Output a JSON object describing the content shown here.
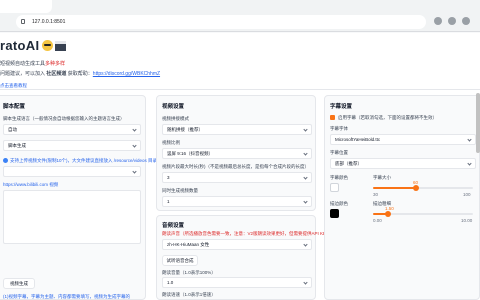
{
  "browser": {
    "url": "127.0.0.1:8501"
  },
  "header": {
    "title": "ratoAI",
    "subtitle_prefix": "短视频自动生成工具",
    "subtitle_highlight": "多种多样",
    "link_line_prefix": "问题建议，可以加入 ",
    "link_line_bold": "社区频道",
    "link_line_mid": " 获取帮助：",
    "link_text": "https://discord.gg/WBKChhmZ",
    "banner": "点击查看教程"
  },
  "left_panel": {
    "title": "脚本配置",
    "language_label": "脚本生成语言（一般情况会自动根据您输入的主题语言生成）",
    "language_value": "自动",
    "mode_value": "脚本生成",
    "hint_text": "支持上传视频文件(限制10个)，大文件建议直接放入 /resource/videos 目录",
    "link_label": "https://www.bilibili.com 视频",
    "gen_button": "视频生成",
    "footer_note": "(1)视频字幕，字幕为主题、内容都需要填写，视频为生成字幕的"
  },
  "mid_panel": {
    "title": "视频设置",
    "source_label": "视频拼接模式",
    "source_value": "随机拼接（推荐）",
    "ratio_label": "视频比例",
    "ratio_value": "竖屏 9:16（抖音视频）",
    "clip_label": "视频片段最大时长(秒)（不是视频最后总长度，是指每个合成片段的长度）",
    "clip_value": "3",
    "count_label": "同时生成视频数量",
    "count_value": "1",
    "audio_title": "音频设置",
    "voice_label": "朗读声音（所选播放音色需要一致，注意：V2版朗读效果更好，但需要提供API KEY）",
    "voice_value": "zh-HK-HiuMaan 女性",
    "try_button": "试听语音合成",
    "volume_label": "朗读音量（1.0表示100%）",
    "volume_value": "1.0",
    "rate_label": "朗读语速（1.0表示1倍速）"
  },
  "right_panel": {
    "title": "字幕设置",
    "enable_label": "启用字幕（若取消勾选，下面的设置都将不生效）",
    "font_label": "字幕字体",
    "font_value": "MicrosoftYaHeiBold.ttc",
    "position_label": "字幕位置",
    "position_value": "底部（推荐）",
    "color_label": "字幕颜色",
    "size_label": "字幕大小",
    "size_value": "60",
    "stroke_color_label": "描边颜色",
    "stroke_width_label": "描边粗细",
    "stroke_width_value": "1.50",
    "size_min": "30",
    "size_max": "100",
    "stroke_min": "0.00",
    "stroke_max": "10.00"
  },
  "colors": {
    "accent": "#f97316",
    "link": "#2563eb",
    "warning": "#dc2626"
  },
  "levels": {
    "font_size_fraction": 0.43,
    "stroke_width_fraction": 0.15
  }
}
